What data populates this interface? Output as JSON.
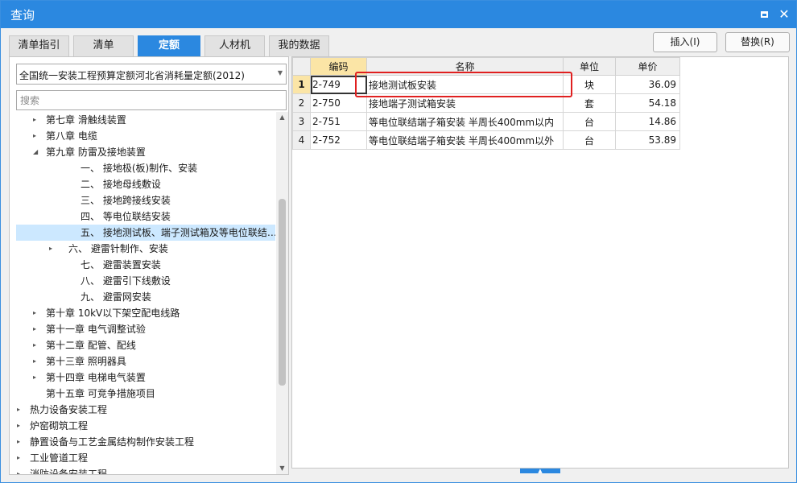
{
  "window": {
    "title": "查询"
  },
  "tabs": [
    {
      "label": "清单指引",
      "active": false
    },
    {
      "label": "清单",
      "active": false
    },
    {
      "label": "定额",
      "active": true
    },
    {
      "label": "人材机",
      "active": false
    },
    {
      "label": "我的数据",
      "active": false
    }
  ],
  "actions": {
    "insert_label": "插入(I)",
    "replace_label": "替换(R)"
  },
  "library": {
    "selected": "全国统一安装工程预算定额河北省消耗量定额(2012)"
  },
  "search": {
    "placeholder": "搜索"
  },
  "tree": [
    {
      "label": "第七章 滑触线装置",
      "toggle": "▸"
    },
    {
      "label": "第八章 电缆",
      "toggle": "▸"
    },
    {
      "label": "第九章 防雷及接地装置",
      "toggle": "◢"
    },
    {
      "label": "一、 接地极(板)制作、安装",
      "toggle": ""
    },
    {
      "label": "二、 接地母线敷设",
      "toggle": ""
    },
    {
      "label": "三、 接地跨接线安装",
      "toggle": ""
    },
    {
      "label": "四、 等电位联结安装",
      "toggle": ""
    },
    {
      "label": "五、 接地测试板、端子测试箱及等电位联结…",
      "toggle": "",
      "selected": true
    },
    {
      "label": "六、 避雷针制作、安装",
      "toggle": "▸"
    },
    {
      "label": "七、 避雷装置安装",
      "toggle": ""
    },
    {
      "label": "八、 避雷引下线敷设",
      "toggle": ""
    },
    {
      "label": "九、 避雷网安装",
      "toggle": ""
    },
    {
      "label": "第十章 10kV以下架空配电线路",
      "toggle": "▸"
    },
    {
      "label": "第十一章 电气调整试验",
      "toggle": "▸"
    },
    {
      "label": "第十二章 配管、配线",
      "toggle": "▸"
    },
    {
      "label": "第十三章 照明器具",
      "toggle": "▸"
    },
    {
      "label": "第十四章 电梯电气装置",
      "toggle": "▸"
    },
    {
      "label": "第十五章 可竞争措施项目",
      "toggle": ""
    },
    {
      "label": "热力设备安装工程",
      "toggle": "▸"
    },
    {
      "label": "炉窑砌筑工程",
      "toggle": "▸"
    },
    {
      "label": "静置设备与工艺金属结构制作安装工程",
      "toggle": "▸"
    },
    {
      "label": "工业管道工程",
      "toggle": "▸"
    },
    {
      "label": "消防设备安装工程",
      "toggle": "▸"
    }
  ],
  "table": {
    "headers": [
      "编码",
      "名称",
      "单位",
      "单价"
    ],
    "rows": [
      {
        "no": "1",
        "code": "2-749",
        "name": "接地测试板安装",
        "unit": "块",
        "price": "36.09"
      },
      {
        "no": "2",
        "code": "2-750",
        "name": "接地端子测试箱安装",
        "unit": "套",
        "price": "54.18"
      },
      {
        "no": "3",
        "code": "2-751",
        "name": "等电位联结端子箱安装 半周长400mm以内",
        "unit": "台",
        "price": "14.86"
      },
      {
        "no": "4",
        "code": "2-752",
        "name": "等电位联结端子箱安装 半周长400mm以外",
        "unit": "台",
        "price": "53.89"
      }
    ]
  },
  "icons": {
    "maximize": "maximize-icon",
    "close": "close-icon",
    "dropdown": "chevron-down-icon"
  },
  "colors": {
    "accent": "#2b88e0",
    "selection": "#cce8ff",
    "highlight": "#fbe5a6",
    "annotation": "#e02020"
  }
}
